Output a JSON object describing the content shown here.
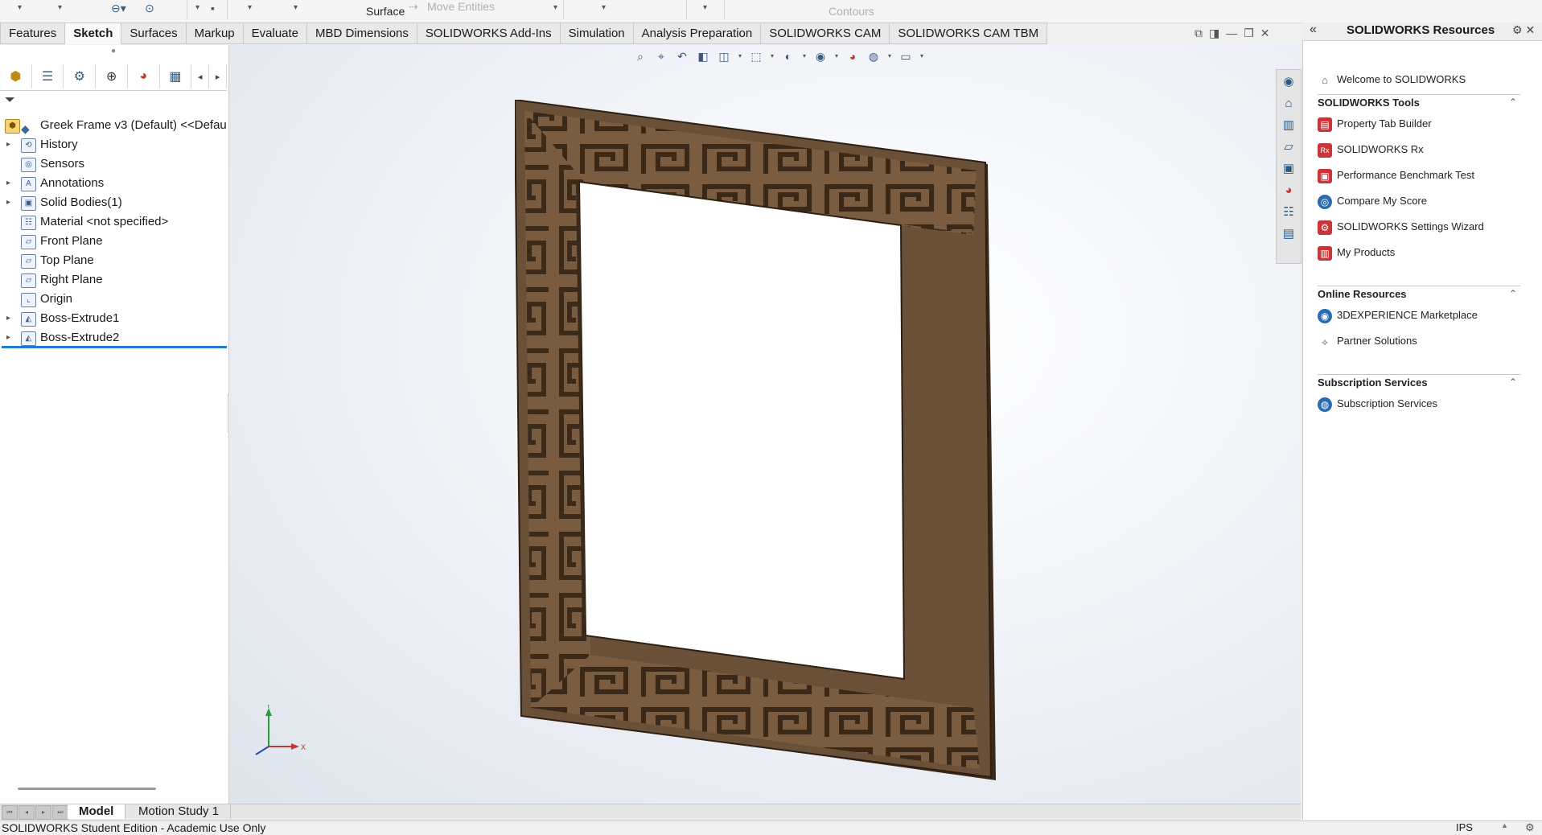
{
  "ribbon": {
    "surface_label": "Surface",
    "move_entities_label": "Move Entities",
    "contours_label": "Contours"
  },
  "tabs": [
    {
      "label": "Features",
      "active": false
    },
    {
      "label": "Sketch",
      "active": true
    },
    {
      "label": "Surfaces",
      "active": false
    },
    {
      "label": "Markup",
      "active": false
    },
    {
      "label": "Evaluate",
      "active": false
    },
    {
      "label": "MBD Dimensions",
      "active": false
    },
    {
      "label": "SOLIDWORKS Add-Ins",
      "active": false
    },
    {
      "label": "Simulation",
      "active": false
    },
    {
      "label": "Analysis Preparation",
      "active": false
    },
    {
      "label": "SOLIDWORKS CAM",
      "active": false
    },
    {
      "label": "SOLIDWORKS CAM TBM",
      "active": false
    }
  ],
  "feature_tree": {
    "root": "Greek Frame v3 (Default) <<Defaul",
    "nodes": [
      {
        "label": "History",
        "expandable": true,
        "icon": "history-icon"
      },
      {
        "label": "Sensors",
        "expandable": false,
        "icon": "sensors-icon"
      },
      {
        "label": "Annotations",
        "expandable": true,
        "icon": "annotations-icon"
      },
      {
        "label": "Solid Bodies(1)",
        "expandable": true,
        "icon": "solid-bodies-icon"
      },
      {
        "label": "Material <not specified>",
        "expandable": false,
        "icon": "material-icon"
      },
      {
        "label": "Front Plane",
        "expandable": false,
        "icon": "plane-icon"
      },
      {
        "label": "Top Plane",
        "expandable": false,
        "icon": "plane-icon"
      },
      {
        "label": "Right Plane",
        "expandable": false,
        "icon": "plane-icon"
      },
      {
        "label": "Origin",
        "expandable": false,
        "icon": "origin-icon"
      },
      {
        "label": "Boss-Extrude1",
        "expandable": true,
        "icon": "extrude-icon"
      },
      {
        "label": "Boss-Extrude2",
        "expandable": true,
        "icon": "extrude-icon"
      }
    ]
  },
  "triad": {
    "x_label": "X",
    "y_label": "Y"
  },
  "resources": {
    "title": "SOLIDWORKS Resources",
    "welcome": "Welcome to SOLIDWORKS",
    "sections": [
      {
        "title": "SOLIDWORKS Tools",
        "items": [
          {
            "label": "Property Tab Builder",
            "icon": "property-tab-builder-icon"
          },
          {
            "label": "SOLIDWORKS Rx",
            "icon": "solidworks-rx-icon"
          },
          {
            "label": "Performance Benchmark Test",
            "icon": "benchmark-icon"
          },
          {
            "label": "Compare My Score",
            "icon": "compare-score-icon"
          },
          {
            "label": "SOLIDWORKS Settings Wizard",
            "icon": "settings-wizard-icon"
          },
          {
            "label": "My Products",
            "icon": "my-products-icon"
          }
        ]
      },
      {
        "title": "Online Resources",
        "items": [
          {
            "label": "3DEXPERIENCE Marketplace",
            "icon": "marketplace-icon"
          },
          {
            "label": "Partner Solutions",
            "icon": "partner-solutions-icon"
          }
        ]
      },
      {
        "title": "Subscription Services",
        "items": [
          {
            "label": "Subscription Services",
            "icon": "subscription-services-icon"
          }
        ]
      }
    ]
  },
  "bottom_tabs": [
    {
      "label": "Model",
      "active": true
    },
    {
      "label": "Motion Study 1",
      "active": false
    }
  ],
  "status": {
    "text": "SOLIDWORKS Student Edition - Academic Use Only",
    "units": "IPS"
  },
  "colors": {
    "frame_outer": "#5a4330",
    "frame_groove": "#3a2818",
    "accent_blue": "#1f7ad1"
  }
}
